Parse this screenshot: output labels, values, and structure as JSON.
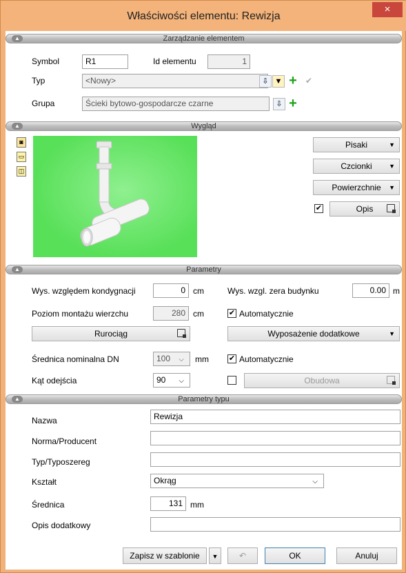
{
  "window": {
    "title": "Właściwości elementu: Rewizja",
    "close": "×"
  },
  "sections": {
    "element": "Zarządzanie elementem",
    "appearance": "Wygląd",
    "params": "Parametry",
    "type_params": "Parametry typu"
  },
  "element": {
    "symbol_label": "Symbol",
    "symbol_value": "R1",
    "id_label": "Id elementu",
    "id_value": "1",
    "type_label": "Typ",
    "type_value": "<Nowy>",
    "group_label": "Grupa",
    "group_value": "Ścieki bytowo-gospodarcze czarne"
  },
  "appearance": {
    "pens": "Pisaki",
    "fonts": "Czcionki",
    "surfaces": "Powierzchnie",
    "description": "Opis",
    "description_checked": true
  },
  "params": {
    "floor_height_label": "Wys. względem kondygnacji",
    "floor_height_value": "0",
    "floor_height_unit": "cm",
    "building_zero_label": "Wys. wzgl. zera budynku",
    "building_zero_value": "0.00",
    "building_zero_unit": "m",
    "top_level_label": "Poziom montażu wierzchu",
    "top_level_value": "280",
    "top_level_unit": "cm",
    "auto1": "Automatycznie",
    "auto1_checked": true,
    "pipe_button": "Rurociąg",
    "extra_equipment": "Wyposażenie dodatkowe",
    "dn_label": "Średnica nominalna DN",
    "dn_value": "100",
    "dn_unit": "mm",
    "auto2": "Automatycznie",
    "auto2_checked": true,
    "angle_label": "Kąt odejścia",
    "angle_value": "90",
    "housing": "Obudowa",
    "housing_checked": false
  },
  "type_params": {
    "name_label": "Nazwa",
    "name_value": "Rewizja",
    "norm_label": "Norma/Producent",
    "norm_value": "",
    "series_label": "Typ/Typoszereg",
    "series_value": "",
    "shape_label": "Kształt",
    "shape_value": "Okrąg",
    "diameter_label": "Średnica",
    "diameter_value": "131",
    "diameter_unit": "mm",
    "extra_label": "Opis dodatkowy",
    "extra_value": ""
  },
  "footer": {
    "save_template": "Zapisz w szablonie",
    "ok": "OK",
    "cancel": "Anuluj"
  }
}
